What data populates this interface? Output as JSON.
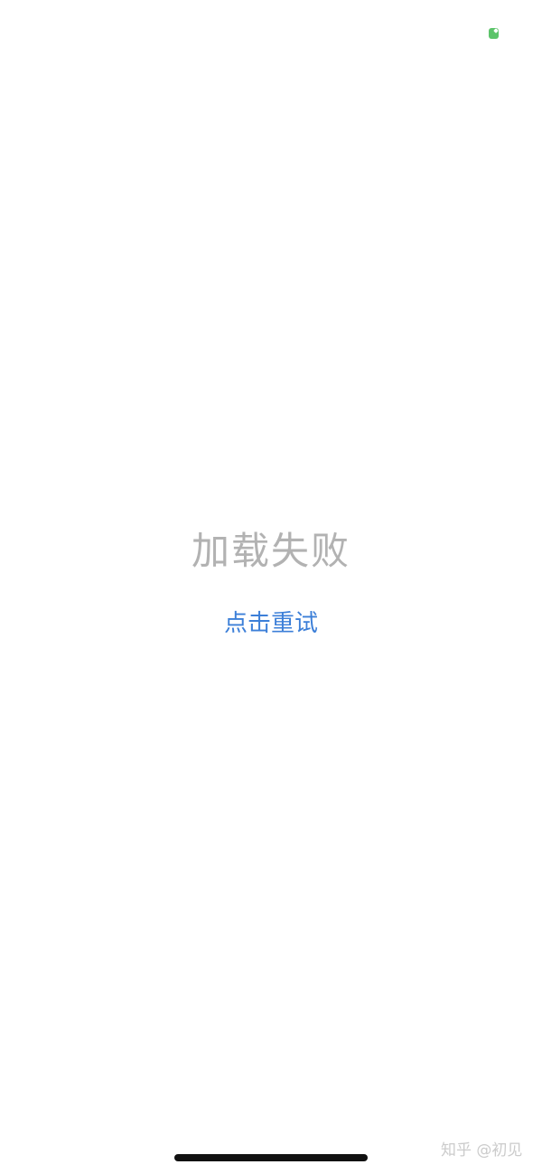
{
  "status_bar": {
    "indicator_icon": "green-rounded-square-icon",
    "indicator_color": "#5cc46a"
  },
  "error": {
    "title": "加载失败",
    "title_color": "#b2b2b2"
  },
  "retry": {
    "label": "点击重试",
    "color": "#3c7fd8"
  },
  "watermark": {
    "text": "知乎 @初见"
  }
}
